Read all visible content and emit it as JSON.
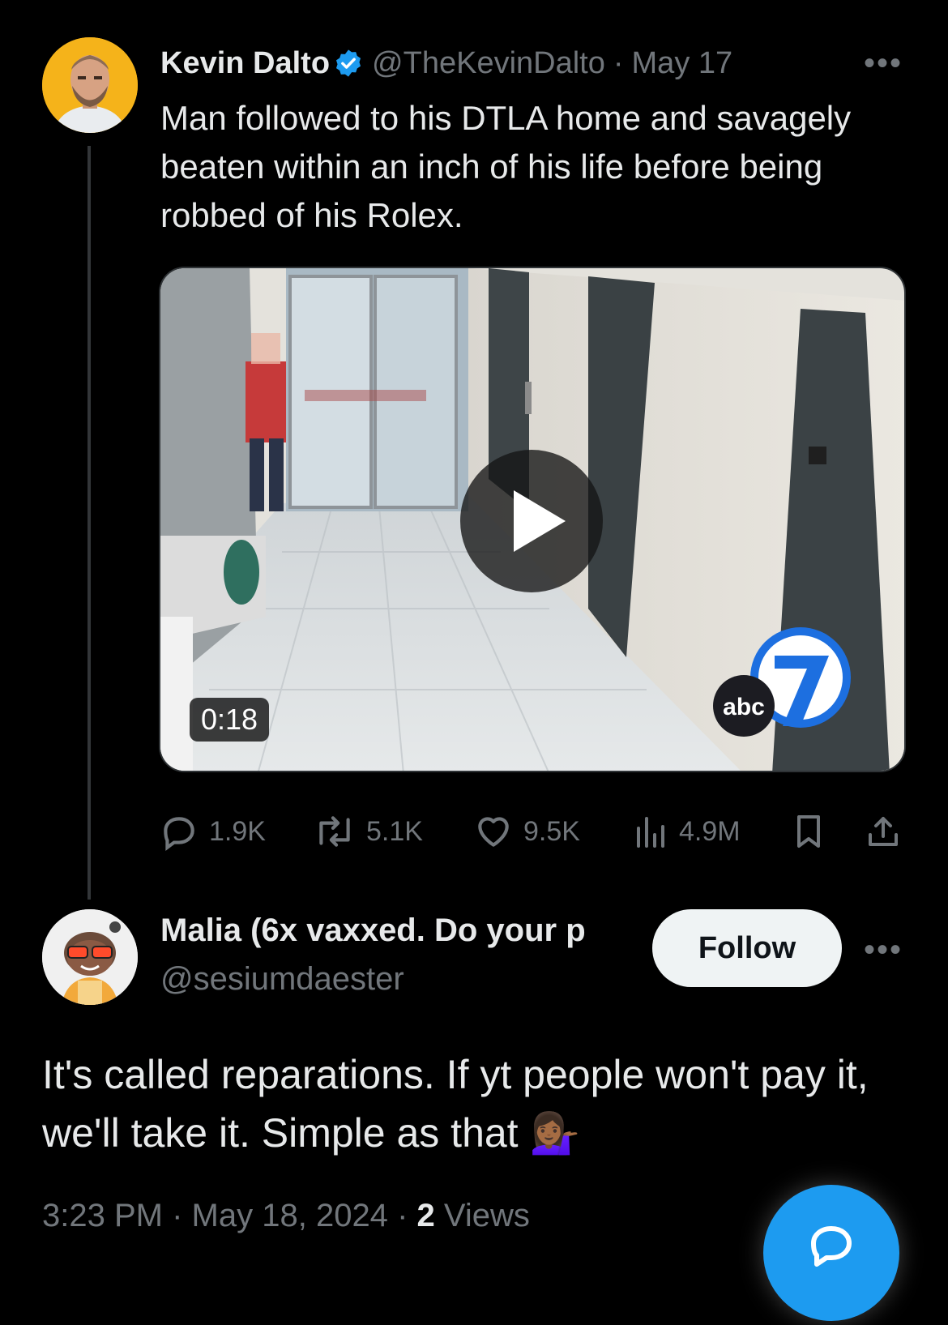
{
  "original_tweet": {
    "author_name": "Kevin Dalto",
    "handle": "@TheKevinDalto",
    "separator": "·",
    "date": "May 17",
    "more": "•••",
    "text": "Man followed to his DTLA home and savagely beaten within an inch of his life before being robbed of his Rolex.",
    "media": {
      "duration": "0:18",
      "watermark_text": "abc"
    },
    "stats": {
      "replies": "1.9K",
      "reposts": "5.1K",
      "likes": "9.5K",
      "views": "4.9M"
    },
    "colors": {
      "verified": "#1d9bf0",
      "avatar_bg": "#f5b31a"
    }
  },
  "reply_tweet": {
    "author_name": "Malia (6x vaxxed. Do your p",
    "handle": "@sesiumdaester",
    "follow_label": "Follow",
    "more": "•••",
    "text": "It's called reparations. If yt people won't pay it, we'll take it. Simple as that",
    "emoji": "💁🏾‍♀️",
    "time": "3:23 PM",
    "separator": "·",
    "date": "May 18, 2024",
    "views_count": "2",
    "views_label": "Views"
  },
  "fab": {
    "icon": "compose-reply-icon",
    "color": "#1d9bf0"
  }
}
